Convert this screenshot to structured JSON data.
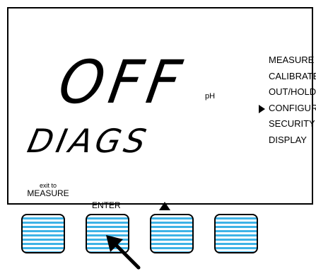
{
  "display": {
    "main_value": "OFF",
    "unit": "pH",
    "sub_value": "DIAGS"
  },
  "menu": {
    "items": [
      {
        "label": "MEASURE"
      },
      {
        "label": "CALIBRATE"
      },
      {
        "label": "OUT/HOLD"
      },
      {
        "label": "CONFIGURE"
      },
      {
        "label": "SECURITY"
      },
      {
        "label": "DISPLAY"
      }
    ],
    "selected": "CONFIGURE"
  },
  "softkey_labels": {
    "exit_small": "exit to",
    "exit_main": "MEASURE",
    "enter": "ENTER",
    "up_icon": "up-triangle-icon"
  },
  "softkeys": [
    "softkey-1",
    "softkey-2",
    "softkey-3",
    "softkey-4"
  ],
  "indicator": {
    "icon": "press-arrow-icon",
    "target": "softkey-2"
  },
  "colors": {
    "button_stripe": "#3eb3e6",
    "button_bg": "#ffffff",
    "outline": "#000000"
  }
}
